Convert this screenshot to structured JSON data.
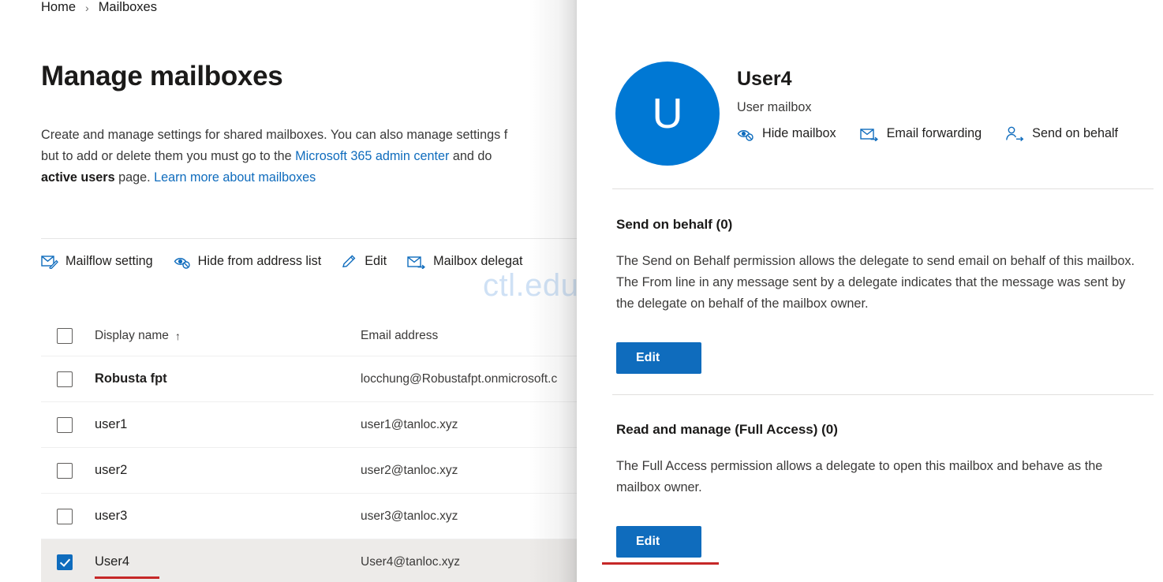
{
  "breadcrumb": {
    "home": "Home",
    "separator": "›",
    "current": "Mailboxes"
  },
  "page": {
    "title": "Manage mailboxes",
    "desc_part1": "Create and manage settings for shared mailboxes. You can also manage settings f",
    "desc_part2": "but to add or delete them you must go to the ",
    "desc_link1": "Microsoft 365 admin center",
    "desc_part3": " and do",
    "desc_bold": "active users",
    "desc_part4": " page. ",
    "desc_link2": "Learn more about mailboxes"
  },
  "toolbar": {
    "items": [
      {
        "label": "Mailflow setting",
        "icon": "mailflow-icon"
      },
      {
        "label": "Hide from address list",
        "icon": "hide-eye-icon"
      },
      {
        "label": "Edit",
        "icon": "pencil-icon"
      },
      {
        "label": "Mailbox delegat",
        "icon": "mailbox-delegation-icon"
      }
    ]
  },
  "table": {
    "columns": [
      "Display name",
      "Email address"
    ],
    "sort_indicator": "↑",
    "rows": [
      {
        "name": "Robusta fpt",
        "email": "locchung@Robustafpt.onmicrosoft.c",
        "checked": false,
        "selected": false,
        "strong": true
      },
      {
        "name": "user1",
        "email": "user1@tanloc.xyz",
        "checked": false,
        "selected": false,
        "strong": false
      },
      {
        "name": "user2",
        "email": "user2@tanloc.xyz",
        "checked": false,
        "selected": false,
        "strong": false
      },
      {
        "name": "user3",
        "email": "user3@tanloc.xyz",
        "checked": false,
        "selected": false,
        "strong": false
      },
      {
        "name": "User4",
        "email": "User4@tanloc.xyz",
        "checked": true,
        "selected": true,
        "strong": false
      }
    ]
  },
  "watermark": {
    "text": "ctl.edu.vn"
  },
  "panel": {
    "avatar_initial": "U",
    "title": "User4",
    "subtitle": "User mailbox",
    "actions": [
      {
        "label": "Hide mailbox",
        "icon": "hide-eye-icon"
      },
      {
        "label": "Email forwarding",
        "icon": "email-forward-icon"
      },
      {
        "label": "Send on behalf",
        "icon": "person-arrow-icon"
      }
    ],
    "sections": [
      {
        "title": "Send on behalf (0)",
        "body": "The Send on Behalf permission allows the delegate to send email on behalf of this mailbox. The From line in any message sent by a delegate indicates that the message was sent by the delegate on behalf of the mailbox owner.",
        "button": "Edit"
      },
      {
        "title": "Read and manage (Full Access) (0)",
        "body": "The Full Access permission allows a delegate to open this mailbox and behave as the mailbox owner.",
        "button": "Edit"
      }
    ]
  },
  "colors": {
    "accent": "#0f6cbd",
    "avatar": "#0078d4",
    "annotation": "#c62828",
    "watermark": "#cfe1f5",
    "row_selected": "#edebe9"
  }
}
